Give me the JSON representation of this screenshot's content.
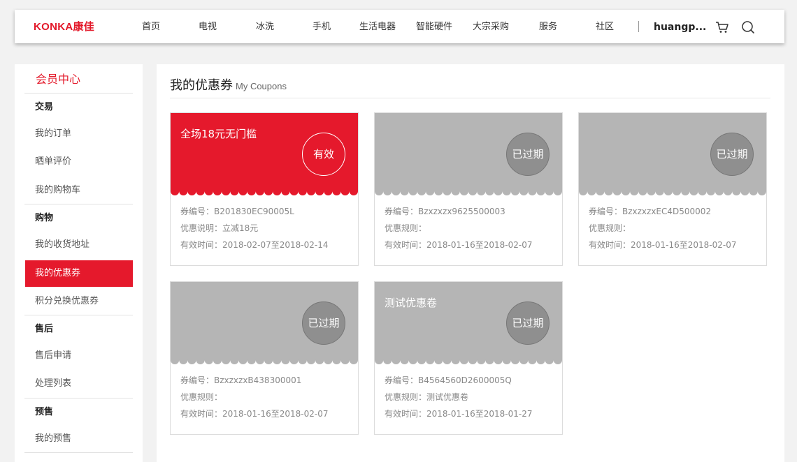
{
  "header": {
    "logo": "KONKA康佳",
    "nav": [
      "首页",
      "电视",
      "冰洗",
      "手机",
      "生活电器",
      "智能硬件",
      "大宗采购",
      "服务",
      "社区"
    ],
    "username": "huangp...",
    "icons": [
      "cart-icon",
      "search-icon"
    ]
  },
  "sidebar": {
    "title": "会员中心",
    "groups": [
      {
        "label": "交易",
        "items": [
          "我的订单",
          "晒单评价",
          "我的购物车"
        ]
      },
      {
        "label": "购物",
        "items": [
          "我的收货地址",
          "我的优惠券",
          "积分兑换优惠券"
        ]
      },
      {
        "label": "售后",
        "items": [
          "售后申请",
          "处理列表"
        ]
      },
      {
        "label": "预售",
        "items": [
          "我的预售"
        ]
      }
    ],
    "active_item": "我的优惠券"
  },
  "main": {
    "title": "我的优惠券",
    "title_en": "My Coupons"
  },
  "coupons": [
    {
      "name": "全场18元无门槛",
      "status": "有效",
      "code": "券编号：B201830EC90005L",
      "desc": "优惠说明：立减18元",
      "period": "有效时间：2018-02-07至2018-02-14",
      "color": "#e5192c"
    },
    {
      "name": "",
      "status": "已过期",
      "code": "券编号：Bzxzxzx9625500003",
      "desc": "优惠规则：",
      "period": "有效时间：2018-01-16至2018-02-07",
      "color": "#b5b5b5"
    },
    {
      "name": "",
      "status": "已过期",
      "code": "券编号：BzxzxzxEC4D500002",
      "desc": "优惠规则：",
      "period": "有效时间：2018-01-16至2018-02-07",
      "color": "#b5b5b5"
    },
    {
      "name": "",
      "status": "已过期",
      "code": "券编号：BzxzxzxB438300001",
      "desc": "优惠规则：",
      "period": "有效时间：2018-01-16至2018-02-07",
      "color": "#b5b5b5"
    },
    {
      "name": "测试优惠卷",
      "status": "已过期",
      "code": "券编号：B4564560D2600005Q",
      "desc": "优惠规则：测试优惠卷",
      "period": "有效时间：2018-01-16至2018-01-27",
      "color": "#b5b5b5"
    }
  ]
}
